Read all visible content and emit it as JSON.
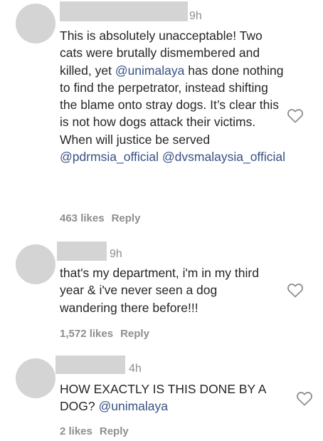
{
  "comments": [
    {
      "time": "9h",
      "text_parts": [
        {
          "t": "This is absolutely unacceptable! Two cats were brutally dismembered and killed, yet ",
          "m": false
        },
        {
          "t": "@unimalaya",
          "m": true
        },
        {
          "t": " has done nothing to find the perpetrator, instead shifting the blame onto stray dogs. It’s clear this is not how dogs attack their victims. When will justice be served ",
          "m": false
        },
        {
          "t": "@pdrmsia_official",
          "m": true
        },
        {
          "t": " ",
          "m": false
        },
        {
          "t": "@dvsmalaysia_official",
          "m": true
        }
      ],
      "likes": "463 likes",
      "reply": "Reply"
    },
    {
      "time": "9h",
      "text_parts": [
        {
          "t": "that's my department, i'm in my third year & i've never seen a dog wandering there before!!!",
          "m": false
        }
      ],
      "likes": "1,572 likes",
      "reply": "Reply"
    },
    {
      "time": "4h",
      "text_parts": [
        {
          "t": "HOW EXACTLY IS THIS DONE BY A DOG? ",
          "m": false
        },
        {
          "t": "@unimalaya",
          "m": true
        }
      ],
      "likes": "2 likes",
      "reply": "Reply"
    }
  ],
  "icons": {
    "like": "heart-outline-icon"
  },
  "colors": {
    "mention": "#385185",
    "meta": "#8e8e8e",
    "text": "#262626",
    "redaction": "#d4d4d4"
  }
}
